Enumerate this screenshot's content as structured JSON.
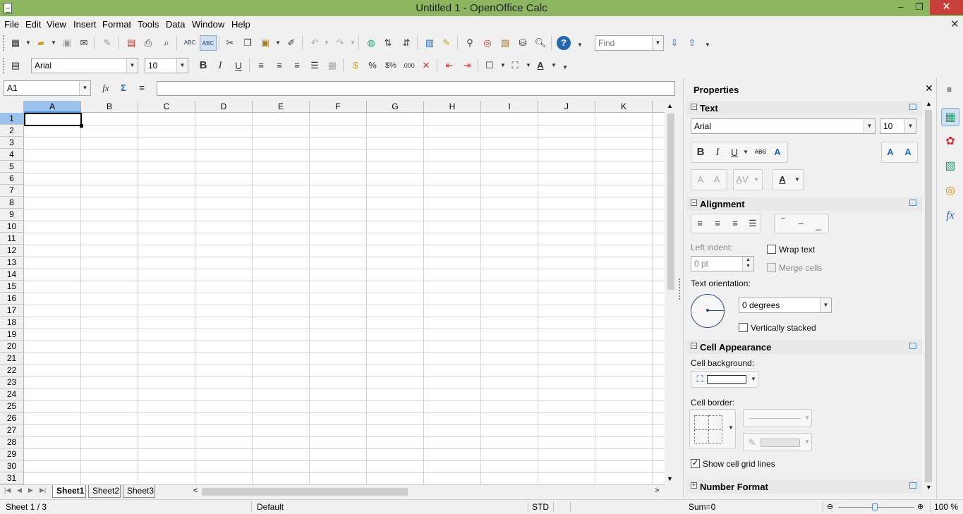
{
  "window": {
    "title": "Untitled 1 - OpenOffice Calc",
    "min": "–",
    "max": "❐",
    "close": "✕"
  },
  "menu": [
    "File",
    "Edit",
    "View",
    "Insert",
    "Format",
    "Tools",
    "Data",
    "Window",
    "Help"
  ],
  "doc_close": "✕",
  "find": {
    "placeholder": "Find"
  },
  "format_toolbar": {
    "font": "Arial",
    "size": "10"
  },
  "formula": {
    "cell_ref": "A1",
    "value": ""
  },
  "columns": [
    "A",
    "B",
    "C",
    "D",
    "E",
    "F",
    "G",
    "H",
    "I",
    "J",
    "K"
  ],
  "rows": [
    "1",
    "2",
    "3",
    "4",
    "5",
    "6",
    "7",
    "8",
    "9",
    "10",
    "11",
    "12",
    "13",
    "14",
    "15",
    "16",
    "17",
    "18",
    "19",
    "20",
    "21",
    "22",
    "23",
    "24",
    "25",
    "26",
    "27",
    "28",
    "29",
    "30",
    "31"
  ],
  "sheets": [
    "Sheet1",
    "Sheet2",
    "Sheet3"
  ],
  "status": {
    "sheet": "Sheet 1 / 3",
    "style": "Default",
    "mode": "STD",
    "sum": "Sum=0",
    "zoom": "100 %"
  },
  "sidebar": {
    "title": "Properties",
    "text": {
      "title": "Text",
      "font": "Arial",
      "size": "10"
    },
    "alignment": {
      "title": "Alignment",
      "left_indent": "Left indent:",
      "indent_value": "0 pt",
      "wrap": "Wrap text",
      "merge": "Merge cells",
      "orientation": "Text orientation:",
      "degrees": "0 degrees",
      "stacked": "Vertically stacked"
    },
    "appearance": {
      "title": "Cell Appearance",
      "background": "Cell background:",
      "border": "Cell border:",
      "gridlines": "Show cell grid lines"
    },
    "number": {
      "title": "Number Format"
    }
  }
}
